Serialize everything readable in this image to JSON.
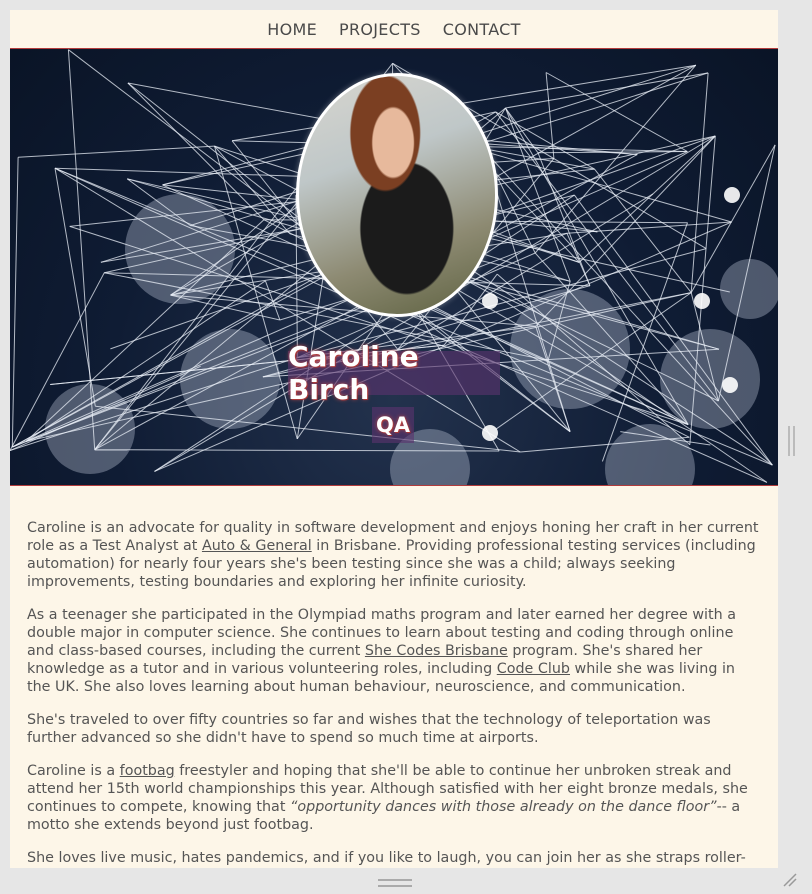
{
  "nav": {
    "items": [
      "HOME",
      "PROJECTS",
      "CONTACT"
    ]
  },
  "hero": {
    "name": "Caroline Birch",
    "role": "QA"
  },
  "about": {
    "p1_a": "Caroline is an advocate for quality in software development and enjoys honing her craft in her current role as a Test Analyst at ",
    "p1_link": "Auto & General",
    "p1_b": " in Brisbane. Providing professional testing services (including automation) for nearly four years she's been testing since she was a child; always seeking improvements, testing boundaries and exploring her infinite curiosity.",
    "p2_a": "As a teenager she participated in the Olympiad maths program and later earned her degree with a double major in computer science. She continues to learn about testing and coding through online and class-based courses, including the current ",
    "p2_link1": "She Codes Brisbane",
    "p2_b": " program. She's shared her knowledge as a tutor and in various volunteering roles, including ",
    "p2_link2": "Code Club",
    "p2_c": " while she was living in the UK. She also loves learning about human behaviour, neuroscience, and communication.",
    "p3": "She's traveled to over fifty countries so far and wishes that the technology of teleportation was further advanced so she didn't have to spend so much time at airports.",
    "p4_a": "Caroline is a ",
    "p4_link": "footbag",
    "p4_b": " freestyler and hoping that she'll be able to continue her unbroken streak and attend her 15th world championships this year. Although satisfied with her eight bronze medals, she continues to compete, knowing that ",
    "p4_quote": "“opportunity dances with those already on the dance floor”",
    "p4_c": "-- a motto she extends beyond just footbag.",
    "p5": "She loves live music, hates pandemics, and if you like to laugh, you can join her as she straps roller-"
  }
}
